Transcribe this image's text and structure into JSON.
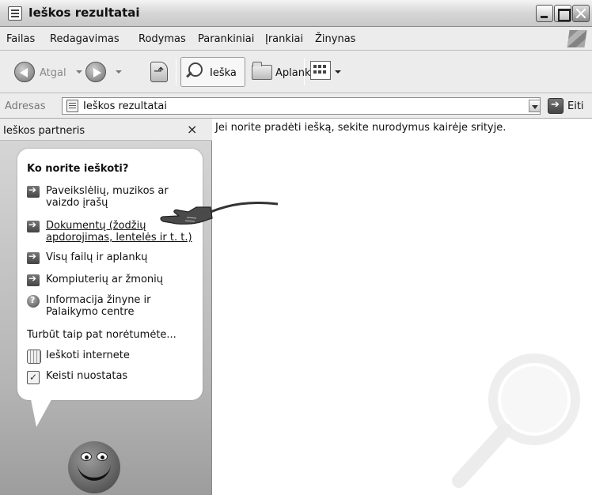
{
  "window": {
    "title": "Ieškos rezultatai"
  },
  "menu": [
    "Failas",
    "Redagavimas",
    "Rodymas",
    "Parankiniai",
    "Įrankiai",
    "Žinynas"
  ],
  "toolbar": {
    "back_label": "Atgal",
    "search_label": "Ieška",
    "folders_label": "Aplankai"
  },
  "address": {
    "label": "Adresas",
    "value": "Ieškos rezultatai",
    "go_label": "Eiti"
  },
  "pane": {
    "title": "Ieškos partneris",
    "close": "×",
    "heading": "Ko norite ieškoti?",
    "options": [
      "Paveikslėlių, muzikos ar vaizdo įrašų",
      "Dokumentų (žodžių apdorojimas, lentelės ir t. t.)",
      "Visų failų ir aplankų",
      "Kompiuterių ar žmonių",
      "Informacija žinyne ir Palaikymo centre"
    ],
    "see_also": "Turbūt taip pat norėtumėte...",
    "extra": [
      "Ieškoti internete",
      "Keisti nuostatas"
    ]
  },
  "content": {
    "message": "Jei norite pradėti iešką, sekite nurodymus kairėje srityje."
  },
  "colors": {
    "chrome": "#ececec",
    "pane": "#c4c4c4",
    "accent": "#555555"
  }
}
